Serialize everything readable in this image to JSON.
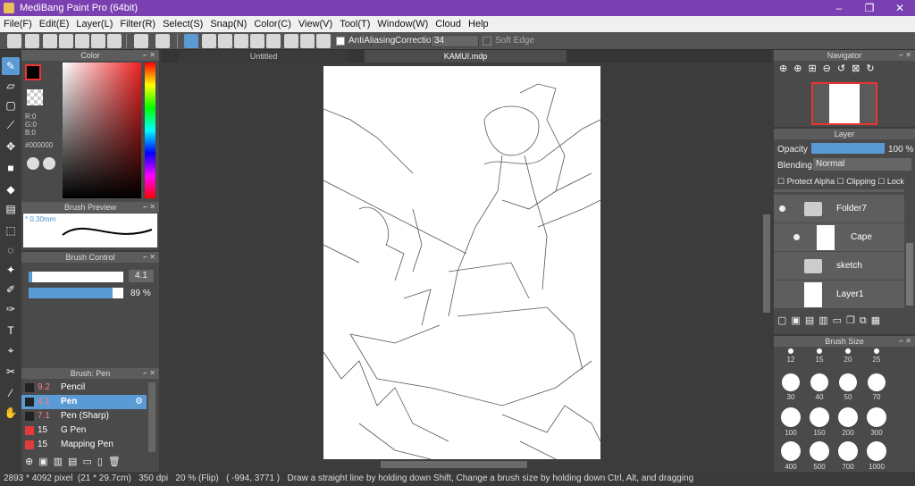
{
  "window": {
    "title": "MediBang Paint Pro (64bit)"
  },
  "menu": [
    "File(F)",
    "Edit(E)",
    "Layer(L)",
    "Filter(R)",
    "Select(S)",
    "Snap(N)",
    "Color(C)",
    "View(V)",
    "Tool(T)",
    "Window(W)",
    "Cloud",
    "Help"
  ],
  "toolbar": {
    "antialiasing": "AntiAliasing",
    "correction_label": "Correction",
    "correction_value": "34",
    "soft_edge": "Soft Edge"
  },
  "color_panel": {
    "title": "Color",
    "r": "R:0",
    "g": "G:0",
    "b": "B:0",
    "hex": "#000000"
  },
  "brush_preview": {
    "title": "Brush Preview",
    "size": "* 0.30mm"
  },
  "brush_control": {
    "title": "Brush Control",
    "size_value": "4.1",
    "opacity_value": "89 %",
    "size_fraction": 0.04,
    "opacity_fraction": 0.89
  },
  "brush_list": {
    "title": "Brush: Pen",
    "items": [
      {
        "size": "9.2",
        "name": "Pencil",
        "color": "#222222"
      },
      {
        "size": "4.1",
        "name": "Pen",
        "color": "#222222"
      },
      {
        "size": "7.1",
        "name": "Pen (Sharp)",
        "color": "#222222"
      },
      {
        "size": "15",
        "name": "G Pen",
        "color": "#e33b3b"
      },
      {
        "size": "15",
        "name": "Mapping Pen",
        "color": "#e33b3b"
      }
    ]
  },
  "tabs": [
    "Untitled",
    "KAMUI.mdp"
  ],
  "navigator": {
    "title": "Navigator"
  },
  "layer_panel": {
    "title": "Layer",
    "opacity_label": "Opacity",
    "opacity_value": "100 %",
    "blending_label": "Blending",
    "blending_value": "Normal",
    "protect_alpha": "Protect Alpha",
    "clipping": "Clipping",
    "lock": "Lock",
    "layers": [
      "Folder7",
      "Cape",
      "sketch",
      "Layer1"
    ]
  },
  "brush_size": {
    "title": "Brush Size",
    "sizes": [
      "12",
      "15",
      "20",
      "25",
      "30",
      "40",
      "50",
      "70",
      "100",
      "150",
      "200",
      "300",
      "400",
      "500",
      "700",
      "1000"
    ]
  },
  "status": {
    "dimensions": "2893 * 4092 pixel",
    "cm": "(21 * 29.7cm)",
    "dpi": "350 dpi",
    "zoom": "20 % (Flip)",
    "coords": "( -994, 3771 )",
    "hint": "Draw a straight line by holding down Shift, Change a brush size by holding down Ctrl, Alt, and dragging"
  }
}
